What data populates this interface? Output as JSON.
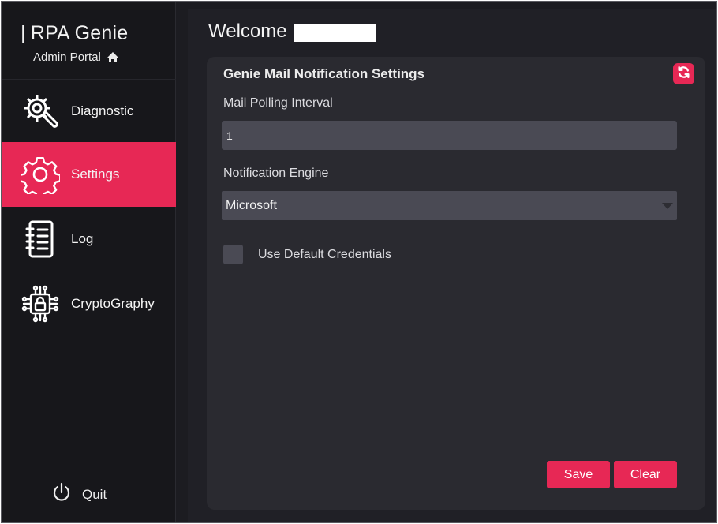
{
  "sidebar": {
    "brand": "RPA Genie",
    "brand_prefix": "|",
    "subtitle": "Admin Portal",
    "items": [
      {
        "label": "Diagnostic",
        "icon": "gear-wrench-icon",
        "active": false
      },
      {
        "label": "Settings",
        "icon": "gear-icon",
        "active": true
      },
      {
        "label": "Log",
        "icon": "notebook-icon",
        "active": false
      },
      {
        "label": "CryptoGraphy",
        "icon": "circuit-lock-icon",
        "active": false
      }
    ],
    "quit_label": "Quit"
  },
  "header": {
    "welcome": "Welcome"
  },
  "card": {
    "title": "Genie Mail Notification Settings",
    "polling_label": "Mail Polling Interval",
    "polling_value": "1",
    "engine_label": "Notification Engine",
    "engine_value": "Microsoft",
    "default_credentials_label": "Use Default Credentials",
    "default_credentials_checked": false,
    "save_label": "Save",
    "clear_label": "Clear"
  },
  "colors": {
    "accent": "#e72855",
    "sidebar_bg": "#17171b",
    "card_bg": "#2a2a30",
    "input_bg": "#4a4a54"
  }
}
